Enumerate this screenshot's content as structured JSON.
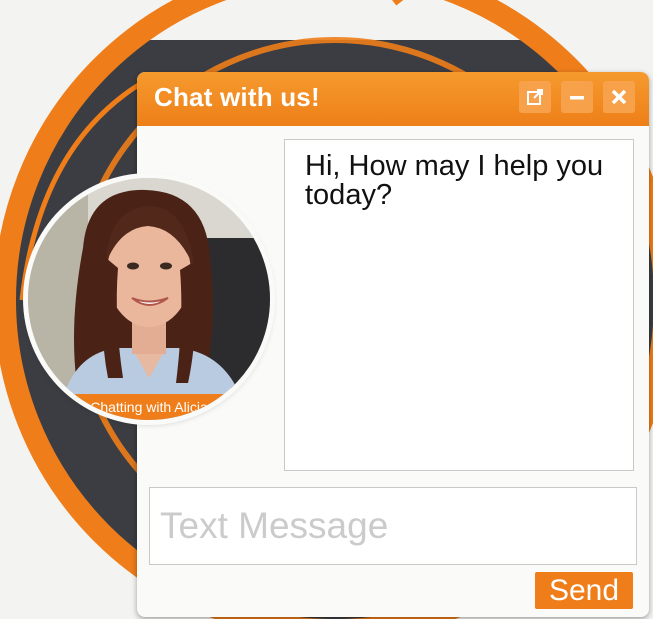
{
  "app": {
    "title": "Chat with us!"
  },
  "titlebar": {
    "buttons": [
      {
        "icon": "popout-icon"
      },
      {
        "icon": "minimize-icon"
      },
      {
        "icon": "close-icon"
      }
    ]
  },
  "agent": {
    "caption": "Chatting with Alicia"
  },
  "conversation": {
    "message": "Hi, How may I help you today?"
  },
  "composer": {
    "placeholder": "Text Message",
    "send_label": "Send"
  },
  "colors": {
    "accent": "#ee7d1a",
    "accent_light": "#f7a24b",
    "dark_band": "#3b3d42",
    "background": "#f3f3f1"
  }
}
